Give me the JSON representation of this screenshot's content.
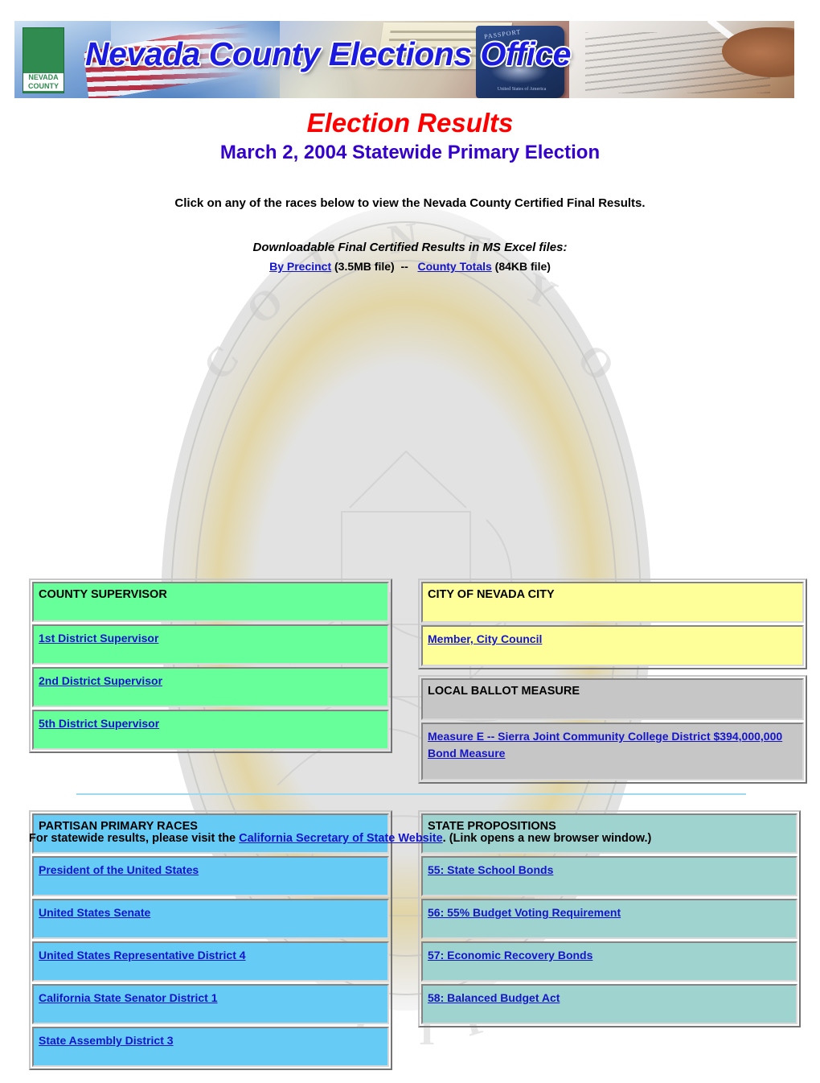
{
  "banner": {
    "title": "Nevada County Elections Office",
    "logo_line1": "NEVADA",
    "logo_line2": "COUNTY",
    "passport_label": "PASSPORT",
    "passport_sub": "United States of America"
  },
  "headings": {
    "main_title": "Election Results",
    "sub_title": "March 2, 2004 Statewide Primary Election",
    "instruction": "Click on any of the races below to view the Nevada County Certified Final Results.",
    "downloads_label": "Downloadable Final Certified Results in MS Excel files:"
  },
  "downloads": {
    "by_precinct_link": "By Precinct",
    "by_precinct_size": "(3.5MB file)",
    "separator": "--",
    "county_totals_link": "County Totals",
    "county_totals_size": "(84KB file)"
  },
  "tables": {
    "supervisor": {
      "header": "COUNTY SUPERVISOR",
      "color": "#66ff99",
      "items": [
        "1st District Supervisor",
        "2nd District Supervisor",
        "5th District Supervisor"
      ]
    },
    "nevada_city": {
      "header": "CITY OF NEVADA CITY",
      "color": "#ffff99",
      "items": [
        "Member, City Council"
      ]
    },
    "ballot_measure": {
      "header": "LOCAL BALLOT MEASURE",
      "color": "#c6c6c6",
      "items": [
        "Measure E -- Sierra Joint Community College District  $394,000,000 Bond Measure"
      ]
    },
    "partisan": {
      "header": "PARTISAN PRIMARY RACES",
      "color": "#66ccf5",
      "items": [
        "President of the United States",
        "United States Senate",
        "United States Representative District 4",
        "California State Senator District 1",
        "State Assembly District 3"
      ]
    },
    "propositions": {
      "header": "STATE PROPOSITIONS",
      "color": "#9fd3d0",
      "items": [
        "55:  State School Bonds",
        "56: 55% Budget Voting Requirement ",
        "57:  Economic Recovery Bonds",
        "58:  Balanced Budget Act"
      ]
    }
  },
  "footer": {
    "prefix": "For statewide results, please visit the ",
    "link": "California Secretary of State Website",
    "suffix": ". (Link opens a new browser window.)"
  },
  "colors": {
    "title_red": "#ff0000",
    "subtitle_blue": "#3300cc",
    "link_blue": "#1414cc",
    "divider_blue": "#9fd9ef"
  }
}
